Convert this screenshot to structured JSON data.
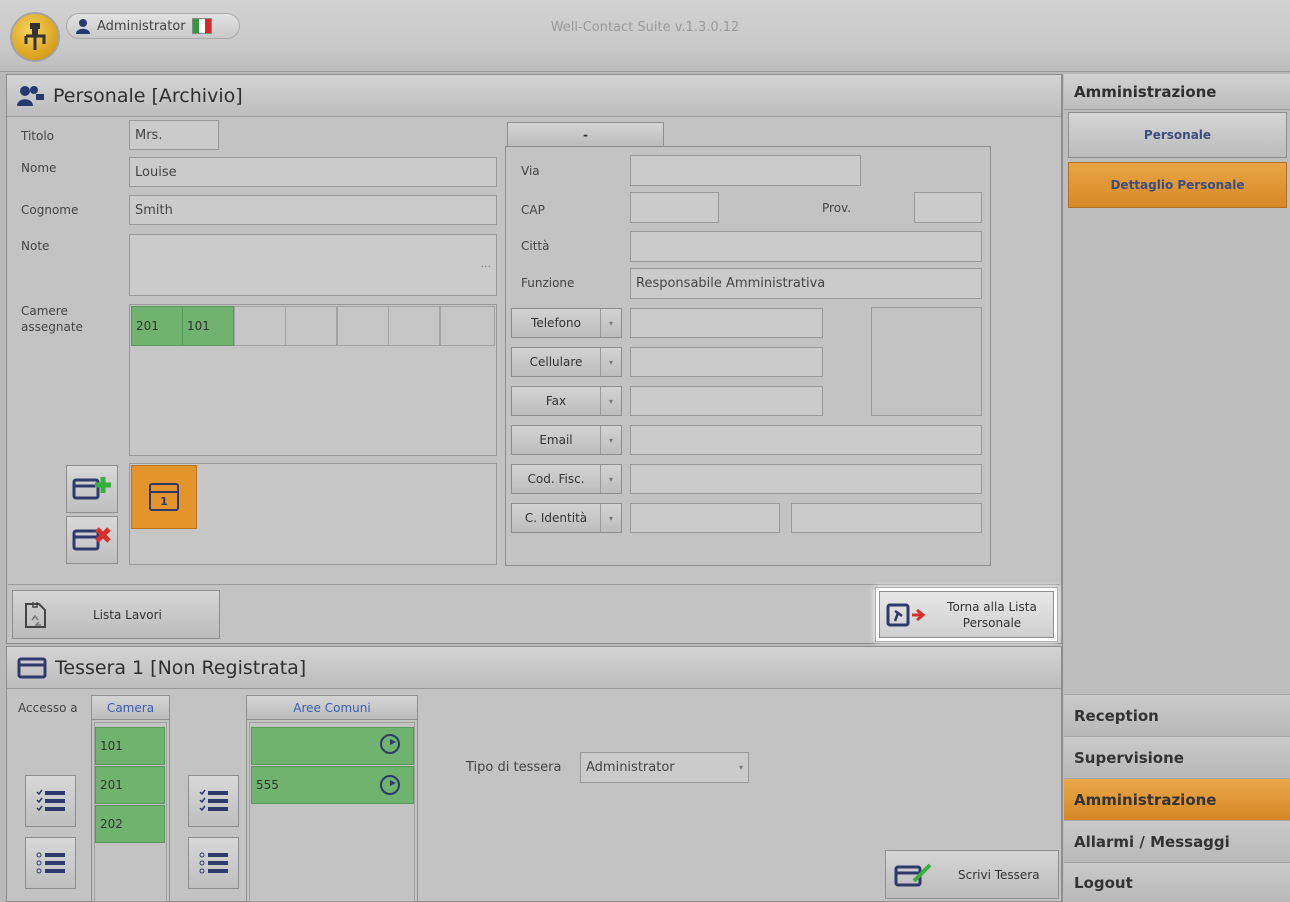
{
  "window": {
    "title": "Well-Contact Suite v.1.3.0.12",
    "user": "Administrator",
    "flag_colors": [
      "#2e9a3a",
      "#ffffff",
      "#d52a2a"
    ]
  },
  "personale": {
    "title": "Personale [Archivio]",
    "titolo_label": "Titolo",
    "titolo_value": "Mrs.",
    "nome_label": "Nome",
    "nome_value": "Louise",
    "cognome_label": "Cognome",
    "cognome_value": "Smith",
    "note_label": "Note",
    "note_ellipsis": "...",
    "camere_label": "Camere assegnate",
    "camere": [
      "201",
      "101"
    ],
    "tessera_number": "1",
    "tab_label": "-",
    "via_label": "Via",
    "via_value": "",
    "cap_label": "CAP",
    "cap_value": "",
    "prov_label": "Prov.",
    "prov_value": "",
    "citta_label": "Città",
    "citta_value": "",
    "funzione_label": "Funzione",
    "funzione_value": "Responsabile Amministrativa",
    "contacts": [
      {
        "label": "Telefono",
        "value": ""
      },
      {
        "label": "Cellulare",
        "value": ""
      },
      {
        "label": "Fax",
        "value": ""
      },
      {
        "label": "Email",
        "value": ""
      },
      {
        "label": "Cod. Fisc.",
        "value": ""
      },
      {
        "label": "C. Identità",
        "value": ""
      }
    ],
    "lista_lavori": "Lista Lavori",
    "torna_lista": "Torna alla Lista Personale"
  },
  "tessera": {
    "title": "Tessera 1 [Non Registrata]",
    "accesso_label": "Accesso a",
    "camera_header": "Camera",
    "camere": [
      "101",
      "201",
      "202"
    ],
    "aree_header": "Aree Comuni",
    "aree": [
      "",
      "555"
    ],
    "tipo_label": "Tipo di tessera",
    "tipo_value": "Administrator",
    "scrivi": "Scrivi Tessera"
  },
  "sidebar": {
    "header": "Amministrazione",
    "items": [
      "Personale",
      "Dettaglio Personale"
    ],
    "sections": [
      "Reception",
      "Supervisione",
      "Amministrazione",
      "Allarmi / Messaggi",
      "Logout"
    ]
  },
  "colors": {
    "accent_orange": "#e3952b",
    "green": "#6fb36f",
    "icon_navy": "#2d3a6b"
  }
}
